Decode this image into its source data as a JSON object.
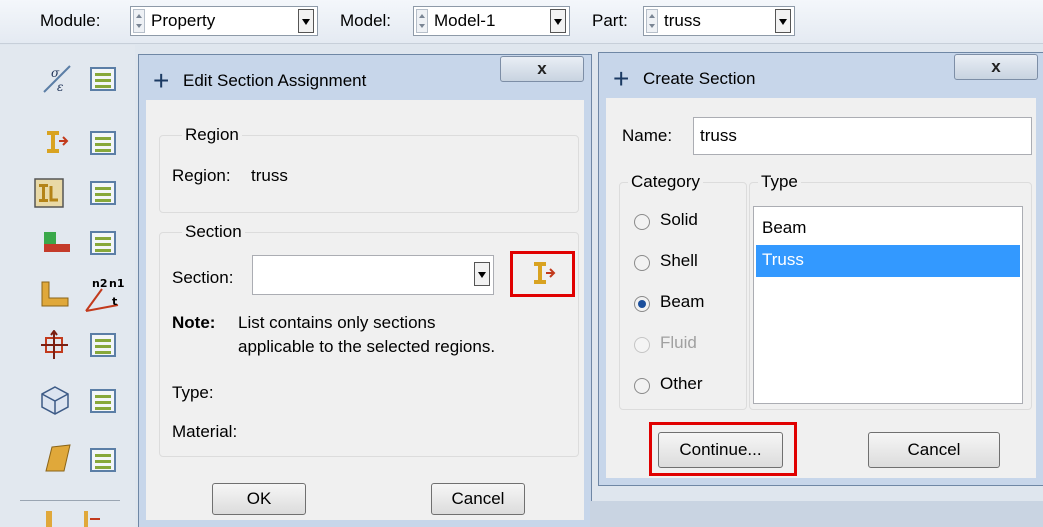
{
  "context_bar": {
    "module_label": "Module:",
    "module_value": "Property",
    "model_label": "Model:",
    "model_value": "Model-1",
    "part_label": "Part:",
    "part_value": "truss"
  },
  "toolbox": {
    "icons": [
      "material-manager-icon",
      "create-profile-icon",
      "assign-section-icon",
      "assign-orientation-icon",
      "beam-orientation-icon",
      "special-icon",
      "composite-icon",
      "skin-icon"
    ]
  },
  "edit_section": {
    "title": "Edit Section Assignment",
    "close": "x",
    "region_legend": "Region",
    "region_label": "Region:",
    "region_value": "truss",
    "section_legend": "Section",
    "section_label": "Section:",
    "section_value": "",
    "note_label": "Note:",
    "note_line1": "List contains only sections",
    "note_line2": "applicable to the selected regions.",
    "type_label": "Type:",
    "material_label": "Material:",
    "ok": "OK",
    "cancel": "Cancel"
  },
  "create_section": {
    "title": "Create Section",
    "close": "x",
    "name_label": "Name:",
    "name_value": "truss",
    "category_legend": "Category",
    "categories": [
      {
        "label": "Solid",
        "checked": false,
        "disabled": false
      },
      {
        "label": "Shell",
        "checked": false,
        "disabled": false
      },
      {
        "label": "Beam",
        "checked": true,
        "disabled": false
      },
      {
        "label": "Fluid",
        "checked": false,
        "disabled": true
      },
      {
        "label": "Other",
        "checked": false,
        "disabled": false
      }
    ],
    "type_legend": "Type",
    "types": [
      "Beam",
      "Truss"
    ],
    "selected_type": "Truss",
    "continue": "Continue...",
    "cancel": "Cancel"
  },
  "colors": {
    "highlight_box": "#e00000",
    "selection": "#3399ff",
    "title_bar": "#c7d6ea"
  }
}
